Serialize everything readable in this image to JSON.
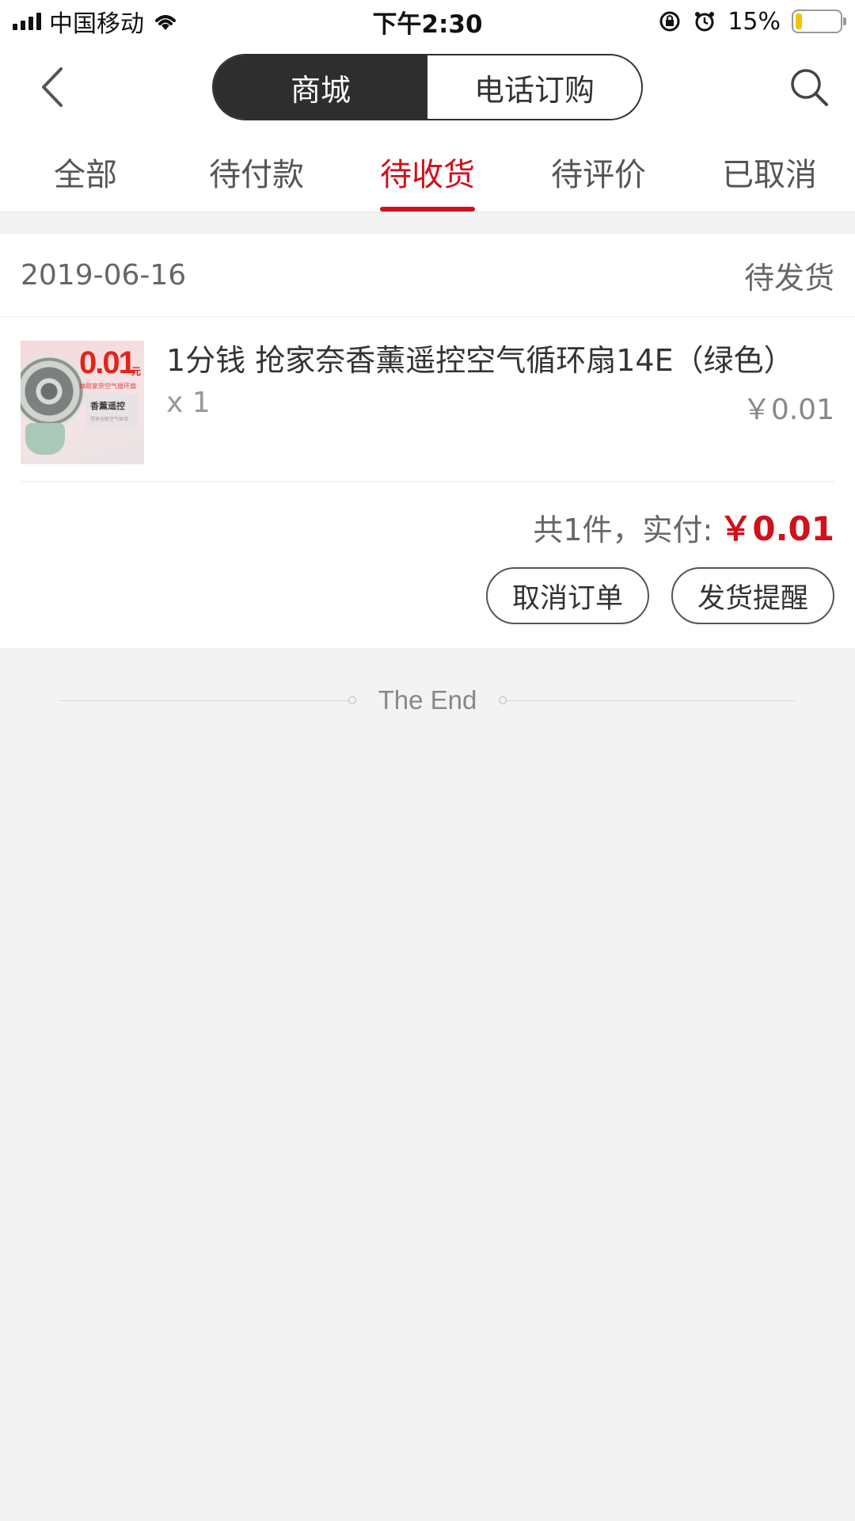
{
  "status_bar": {
    "carrier": "中国移动",
    "time": "下午2:30",
    "battery_percent": "15%",
    "battery_level": 0.15,
    "icons": [
      "signal-icon",
      "wifi-icon",
      "rotation-lock-icon",
      "alarm-icon",
      "battery-icon"
    ]
  },
  "nav": {
    "segments": [
      {
        "label": "商城",
        "active": true
      },
      {
        "label": "电话订购",
        "active": false
      }
    ],
    "icons": [
      "back-chevron-icon",
      "search-icon"
    ]
  },
  "tabs": [
    {
      "label": "全部",
      "active": false
    },
    {
      "label": "待付款",
      "active": false
    },
    {
      "label": "待收货",
      "active": true
    },
    {
      "label": "待评价",
      "active": false
    },
    {
      "label": "已取消",
      "active": false
    }
  ],
  "order": {
    "date": "2019-06-16",
    "status": "待发货",
    "product": {
      "title": "1分钱 抢家奈香薰遥控空气循环扇14E（绿色）",
      "quantity": "x 1",
      "price": "￥0.01",
      "thumb": {
        "price_text": "0.01",
        "unit_text": "元",
        "line1": "抽取家奈空气循环扇",
        "tag": "香薰遥控",
        "tag_sub": "带来全新空气体验"
      }
    },
    "summary_label": "共1件，实付:",
    "summary_amount": "￥0.01",
    "actions": [
      {
        "label": "取消订单"
      },
      {
        "label": "发货提醒"
      }
    ]
  },
  "footer": {
    "end_text": "The End"
  },
  "colors": {
    "accent": "#d0111b",
    "segment_active_bg": "#2e2e2e",
    "page_bg": "#f3f3f3"
  }
}
